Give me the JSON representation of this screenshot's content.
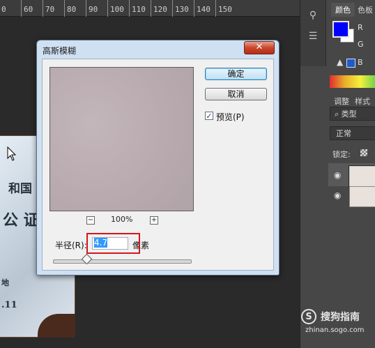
{
  "ruler": {
    "labels": [
      "60",
      "70",
      "80",
      "90",
      "100",
      "110",
      "120",
      "130",
      "140",
      "150"
    ],
    "first_partial": "0"
  },
  "canvas": {
    "card_text": [
      "和国",
      "公 证",
      "地",
      ".11"
    ]
  },
  "right_panel": {
    "tabs": {
      "color": "颜色",
      "swatches": "色板",
      "adjust": "调整",
      "styles": "样式"
    },
    "channels": {
      "r": "R",
      "g": "G",
      "b": "B"
    },
    "kind_filter": "类型",
    "blend_mode": "正常",
    "lock_label": "锁定:",
    "fg_color": "#0000ff",
    "bg_color": "#ffffff"
  },
  "dialog": {
    "title": "高斯模糊",
    "close": "✕",
    "ok": "确定",
    "cancel": "取消",
    "preview_label": "预览(P)",
    "preview_checked": "✓",
    "zoom_out": "−",
    "zoom_level": "100%",
    "zoom_in": "+",
    "radius_label": "半径(R):",
    "radius_value": "4.7",
    "radius_unit": "像素"
  },
  "watermark": {
    "logo": "S",
    "title": "搜狗指南",
    "url": "zhinan.sogo.com"
  }
}
